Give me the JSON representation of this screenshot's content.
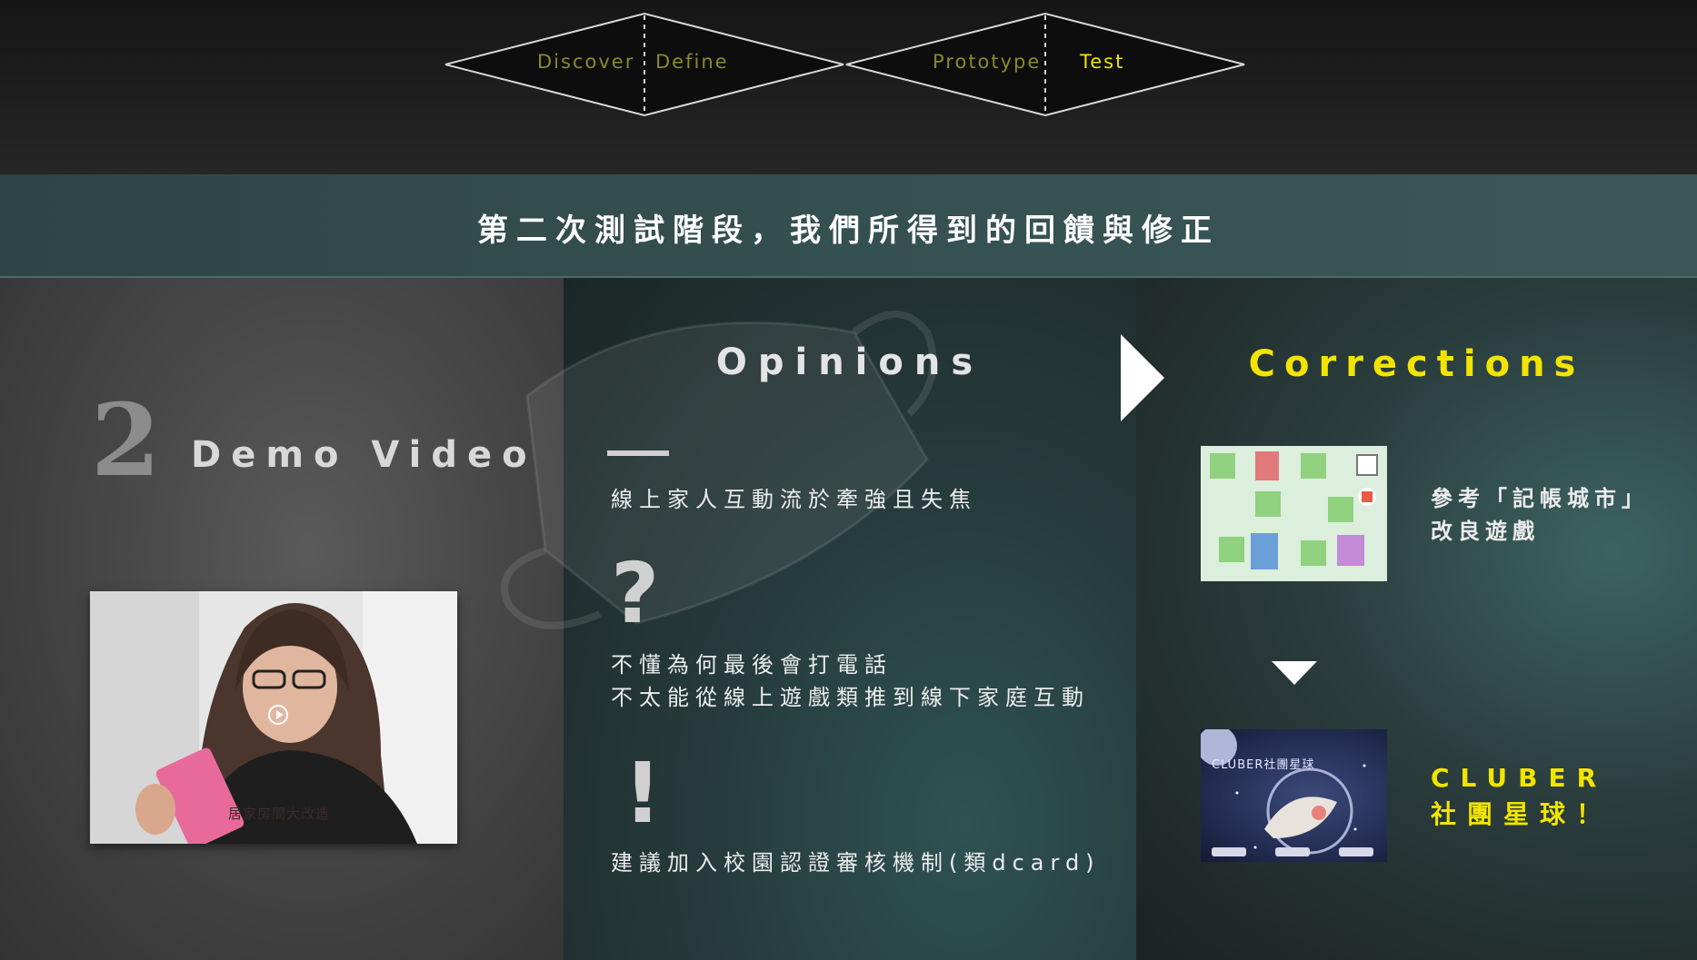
{
  "process": {
    "stages": [
      {
        "label": "Discover",
        "color": "#8a8a2a"
      },
      {
        "label": "Define",
        "color": "#8a8a2a"
      },
      {
        "label": "Prototype",
        "color": "#8a8a2a"
      },
      {
        "label": "Test",
        "color": "#f2e400"
      }
    ]
  },
  "title": "第二次測試階段，我們所得到的回饋與修正",
  "left": {
    "number": "2",
    "label": "Demo Video",
    "video_caption": "居家房間大改造"
  },
  "opinions": {
    "heading": "Opinions",
    "items": [
      {
        "symbol": "—",
        "lines": [
          "線上家人互動流於牽強且失焦"
        ]
      },
      {
        "symbol": "?",
        "lines": [
          "不懂為何最後會打電話",
          "不太能從線上遊戲類推到線下家庭互動"
        ]
      },
      {
        "symbol": "!",
        "lines": [
          "建議加入校園認證審核機制(類dcard)"
        ]
      }
    ]
  },
  "corrections": {
    "heading": "Corrections",
    "first": {
      "line1": "參考「記帳城市」",
      "line2": "改良遊戲"
    },
    "second": {
      "line1": "CLUBER",
      "line2": "社團星球！",
      "image_title": "CLUBER社團星球"
    }
  },
  "colors": {
    "accent_yellow": "#f2e400",
    "teal_band": "#355050",
    "olive_stage": "#8a8a2a"
  }
}
